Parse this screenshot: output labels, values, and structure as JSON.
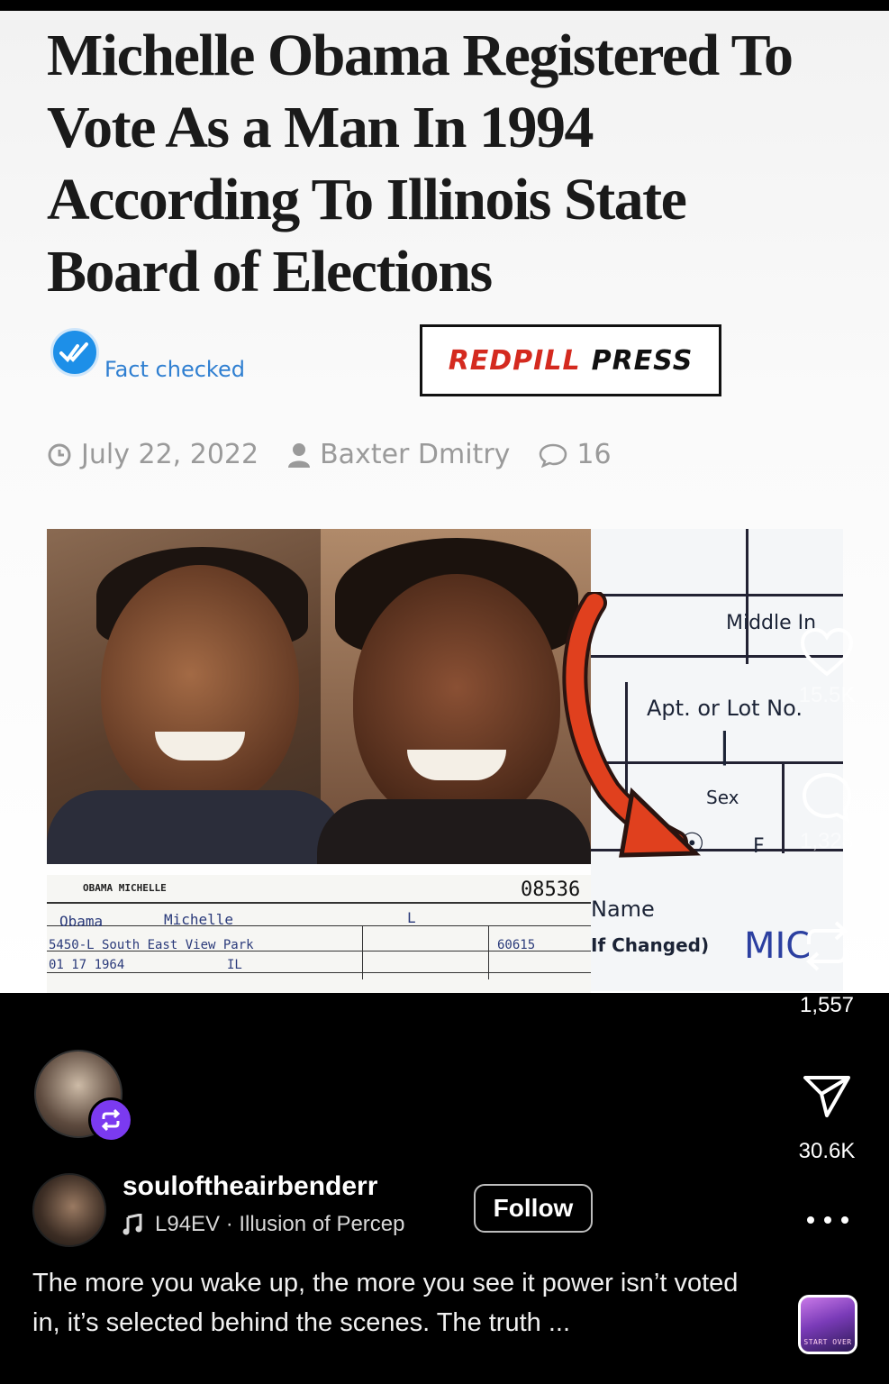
{
  "article": {
    "headline": "Michelle Obama Registered To Vote As a Man In 1994 According To Illinois State Board of Elections",
    "fact_checked": "Fact checked",
    "brand_red": "REDPILL",
    "brand_black": "PRESS",
    "date": "July 22, 2022",
    "author": "Baxter Dmitry",
    "comments": "16",
    "form": {
      "middle_in": "Middle In",
      "apt": "Apt. or Lot No.",
      "sex": "Sex",
      "sex_f": "F",
      "serial": "08536",
      "name": "Name",
      "if_changed": "If Changed)",
      "mic": "MIC",
      "header_name": "OBAMA MICHELLE",
      "last": "Obama",
      "first": "Michelle",
      "middle": "L",
      "address": "5450-L South East View Park",
      "zip": "60615",
      "birth": "01 17 1964",
      "state": "IL"
    }
  },
  "rail": {
    "likes": "15.5K",
    "comments": "1,328",
    "reposts": "1,557",
    "shares": "30.6K"
  },
  "post": {
    "username": "souloftheairbenderr",
    "music": "L94EV · Illusion of Percep",
    "follow_label": "Follow",
    "caption": "The more you wake up, the more you see it power isn’t voted in, it’s selected behind the scenes. The truth ...",
    "music_thumb_text": "START OVER"
  },
  "colors": {
    "accent_purple": "#7b3af0",
    "brand_red": "#d42a1f",
    "fact_blue": "#1d8fe8"
  }
}
